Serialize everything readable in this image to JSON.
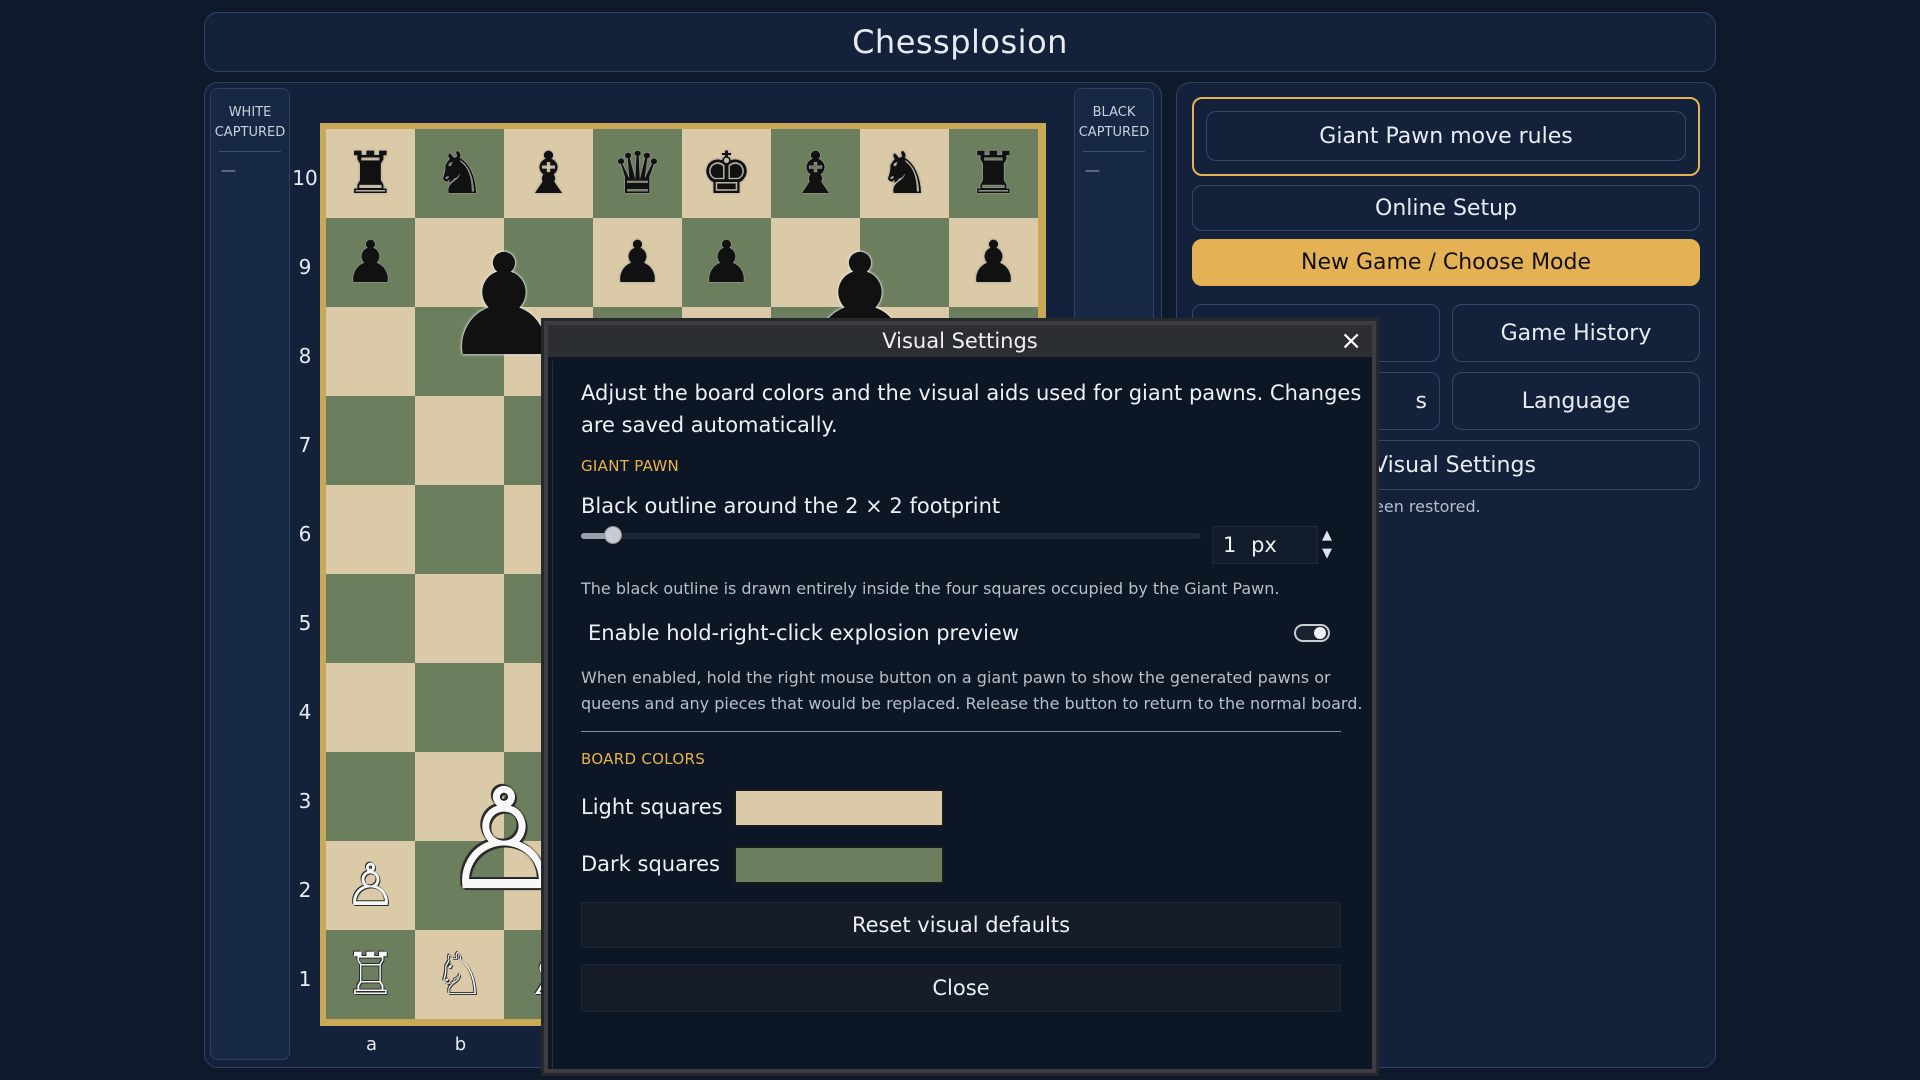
{
  "app": {
    "title": "Chessplosion"
  },
  "captured": {
    "white_title": "WHITE\nCAPTURED",
    "white_items": "—",
    "black_title": "BLACK\nCAPTURED",
    "black_items": "—"
  },
  "board": {
    "ranks": [
      "10",
      "9",
      "8",
      "7",
      "6",
      "5",
      "4",
      "3",
      "2",
      "1"
    ],
    "files": [
      "a",
      "b"
    ],
    "light_color": "#dbcaa7",
    "dark_color": "#6b7f5e",
    "pieces": {
      "rank10": [
        "♜",
        "♞",
        "♝",
        "♛",
        "♚",
        "♝",
        "♞",
        "♜"
      ],
      "rank9_a": "♟",
      "rank9_d": "♟",
      "rank9_e": "♟",
      "rank9_h": "♟",
      "giant_black_1": "♟",
      "giant_black_2": "♟",
      "giant_white": "♙",
      "rank2_a": "♙",
      "rank1_a": "♖",
      "rank1_b": "♘",
      "rank1_c": "♗"
    }
  },
  "side": {
    "giant_rules": "Giant Pawn move rules",
    "online_setup": "Online Setup",
    "new_game": "New Game / Choose Mode",
    "game_history": "Game History",
    "language": "Language",
    "left_btn_2_visible": "s",
    "visual_settings": "Visual Settings",
    "status_visible": "een restored."
  },
  "modal": {
    "title": "Visual Settings",
    "close_icon": "×",
    "intro_line1": "Adjust the board colors and the visual aids used for giant pawns. Changes",
    "intro_line2": "are saved automatically.",
    "section_giant": "GIANT PAWN",
    "outline_label": "Black outline around the 2 × 2 footprint",
    "outline_value": "1",
    "outline_unit": "px",
    "outline_help": "The black outline is drawn entirely inside the four squares occupied by the Giant Pawn.",
    "preview_label": "Enable hold-right-click explosion preview",
    "preview_enabled": true,
    "preview_help_1": "When enabled, hold the right mouse button on a giant pawn to show the generated pawns or",
    "preview_help_2": "queens and any pieces that would be replaced. Release the button to return to the normal board.",
    "section_colors": "BOARD COLORS",
    "light_label": "Light squares",
    "dark_label": "Dark squares",
    "reset_label": "Reset visual defaults",
    "close_label": "Close"
  }
}
